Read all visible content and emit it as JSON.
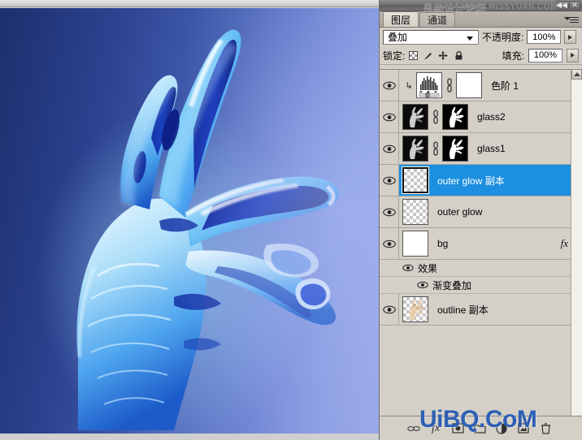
{
  "app": {
    "watermark_top_cn": "思缘设计论坛",
    "watermark_top_en": "WWW.MISSYUAN.COM",
    "watermark_bottom": "UiBQ.CoM"
  },
  "titlebar": {
    "collapse_label": "◀◀",
    "close_label": "✕"
  },
  "tabs": [
    {
      "label": "图层",
      "name": "tab-layers",
      "active": true
    },
    {
      "label": "通道",
      "name": "tab-channels",
      "active": false
    }
  ],
  "blend": {
    "mode_value": "叠加",
    "opacity_label": "不透明度:",
    "opacity_value": "100%"
  },
  "lock": {
    "label": "锁定:",
    "icons": [
      "lock-transparent-pixels-icon",
      "lock-image-pixels-icon",
      "lock-position-icon",
      "lock-all-icon"
    ],
    "fill_label": "填充:",
    "fill_value": "100%"
  },
  "layers": [
    {
      "name": "色阶 1",
      "type": "adjustment-levels",
      "visible": true,
      "selected": false,
      "clipped": true,
      "linked": true,
      "has_mask": true,
      "has_fx": false
    },
    {
      "name": "glass2",
      "type": "pixel",
      "visible": true,
      "selected": false,
      "clipped": false,
      "linked": true,
      "has_mask": true,
      "has_fx": false
    },
    {
      "name": "glass1",
      "type": "pixel",
      "visible": true,
      "selected": false,
      "clipped": false,
      "linked": true,
      "has_mask": true,
      "has_fx": false
    },
    {
      "name": "outer glow 副本",
      "type": "transparent",
      "visible": true,
      "selected": true,
      "clipped": false,
      "linked": false,
      "has_mask": false,
      "has_fx": false
    },
    {
      "name": "outer glow",
      "type": "transparent",
      "visible": true,
      "selected": false,
      "clipped": false,
      "linked": false,
      "has_mask": false,
      "has_fx": false
    },
    {
      "name": "bg",
      "type": "white",
      "visible": true,
      "selected": false,
      "clipped": false,
      "linked": false,
      "has_mask": false,
      "has_fx": true,
      "fx_label": "fx"
    }
  ],
  "effects": {
    "group_label": "效果",
    "items": [
      "渐变叠加"
    ]
  },
  "bottom_layer": {
    "name": "outline 副本",
    "type": "outline",
    "visible": true,
    "selected": false
  },
  "panel_bottom_buttons": [
    {
      "name": "link-layers-button",
      "glyph": "⛓"
    },
    {
      "name": "layer-style-button",
      "glyph": "fx"
    },
    {
      "name": "add-mask-button",
      "glyph": "◻"
    },
    {
      "name": "new-group-button",
      "glyph": "🗀"
    },
    {
      "name": "new-adjustment-layer-button",
      "glyph": "◑"
    },
    {
      "name": "new-layer-button",
      "glyph": "▣"
    },
    {
      "name": "delete-layer-button",
      "glyph": "🗑"
    }
  ],
  "colors": {
    "selection_blue": "#1d8fe0",
    "panel_gray": "#d4d0c8",
    "canvas_dark": "#1d2f6e",
    "canvas_light": "#9aa9e8",
    "watermark_blue": "#2e5fb5"
  },
  "canvas": {
    "subject": "ice-glass-hand",
    "background_gradient": "dark-navy-to-periwinkle"
  }
}
